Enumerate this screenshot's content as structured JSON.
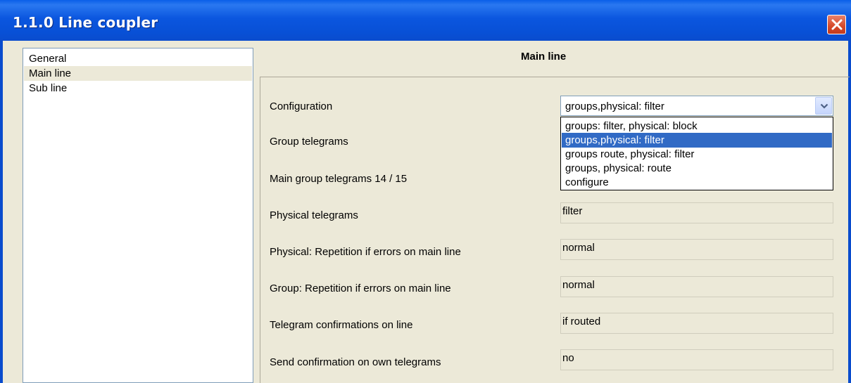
{
  "window": {
    "title": "1.1.0 Line coupler"
  },
  "navigation": {
    "items": [
      {
        "label": "General",
        "selected": false
      },
      {
        "label": "Main line",
        "selected": true
      },
      {
        "label": "Sub line",
        "selected": false
      }
    ]
  },
  "main": {
    "section_title": "Main line",
    "configuration": {
      "label": "Configuration",
      "value": "groups,physical: filter",
      "options": [
        "groups: filter, physical: block",
        "groups,physical: filter",
        "groups route, physical: filter",
        "groups, physical: route",
        "configure"
      ],
      "highlighted_index": 1
    },
    "params": {
      "group_telegrams": {
        "label": "Group telegrams"
      },
      "main_group_telegrams": {
        "label": "Main group telegrams 14 / 15"
      },
      "physical_telegrams": {
        "label": "Physical telegrams",
        "value": "filter"
      },
      "physical_repetition": {
        "label": "Physical: Repetition if errors on main line",
        "value": "normal"
      },
      "group_repetition": {
        "label": "Group: Repetition if errors on main line",
        "value": "normal"
      },
      "telegram_confirmations": {
        "label": "Telegram confirmations on line",
        "value": "if routed"
      },
      "send_confirmation": {
        "label": "Send confirmation on own telegrams",
        "value": "no"
      }
    }
  },
  "colors": {
    "titlebar": "#0a56df",
    "selection": "#316ac5",
    "window_bg": "#ece9d8",
    "close": "#d6492a"
  }
}
